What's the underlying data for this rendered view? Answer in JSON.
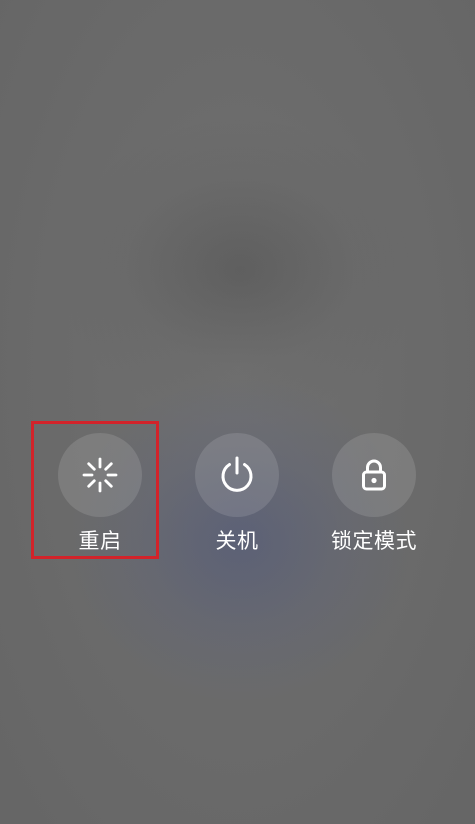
{
  "power_menu": {
    "restart": {
      "label": "重启",
      "icon": "restart-spinner-icon"
    },
    "shutdown": {
      "label": "关机",
      "icon": "power-icon"
    },
    "lockdown": {
      "label": "锁定模式",
      "icon": "lock-icon"
    }
  },
  "colors": {
    "background": "#6b6b6b",
    "button_circle": "rgba(255,255,255,0.12)",
    "text": "#ffffff",
    "highlight": "#d2232a"
  }
}
